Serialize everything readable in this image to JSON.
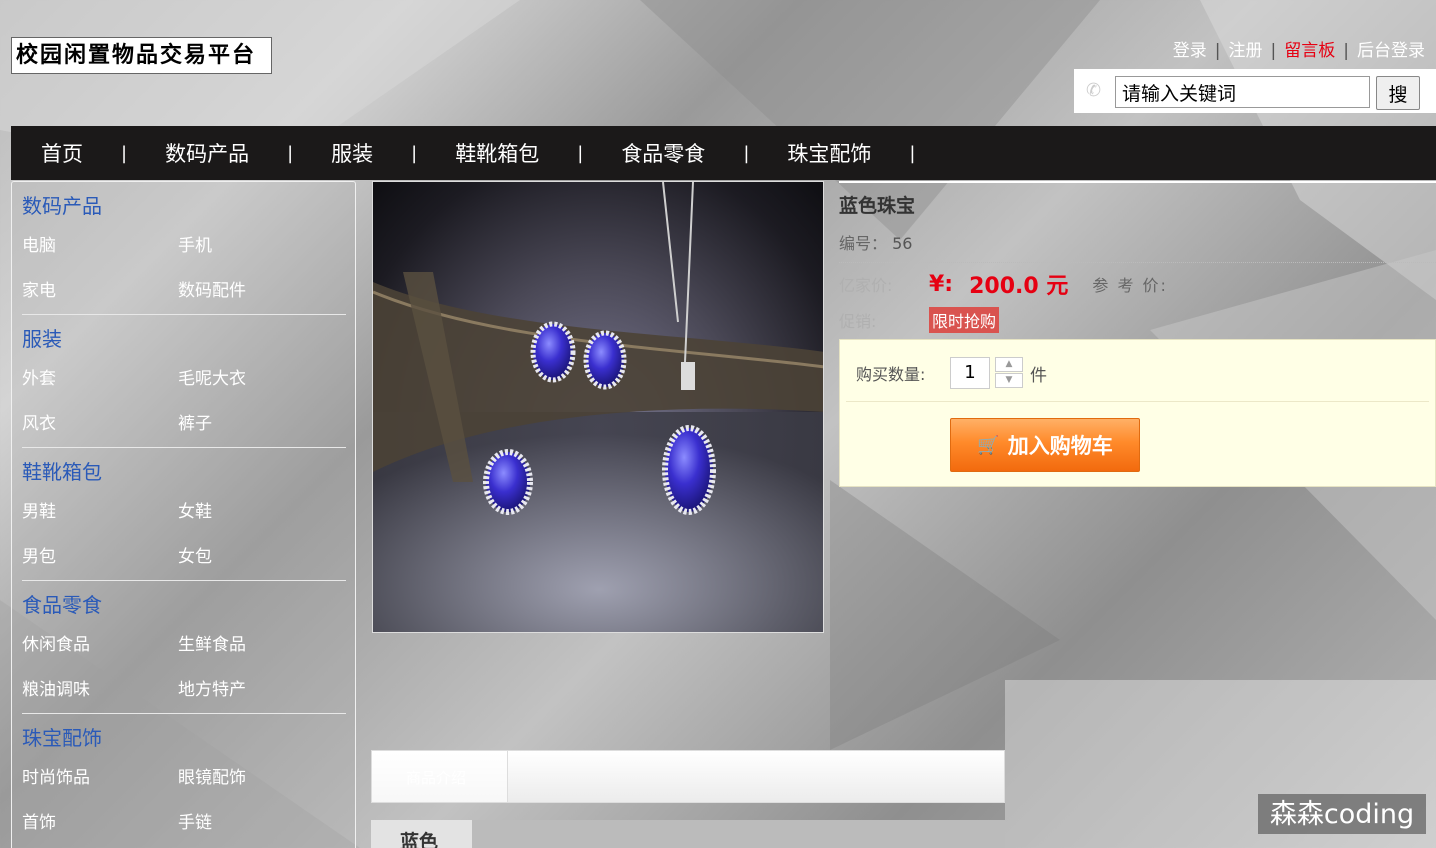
{
  "logo": {
    "text": "校园闲置物品交易平台"
  },
  "top_links": {
    "login": "登录",
    "register": "注册",
    "guestbook": "留言板",
    "admin": "后台登录",
    "sep": "|"
  },
  "search": {
    "value": "请输入关键词",
    "button": "搜"
  },
  "nav": {
    "items": [
      "首页",
      "数码产品",
      "服装",
      "鞋靴箱包",
      "食品零食",
      "珠宝配饰"
    ],
    "sep": "|"
  },
  "sidebar": [
    {
      "title": "数码产品",
      "items": [
        "电脑",
        "手机",
        "家电",
        "数码配件"
      ]
    },
    {
      "title": "服装",
      "items": [
        "外套",
        "毛呢大衣",
        "风衣",
        "裤子"
      ]
    },
    {
      "title": "鞋靴箱包",
      "items": [
        "男鞋",
        "女鞋",
        "男包",
        "女包"
      ]
    },
    {
      "title": "食品零食",
      "items": [
        "休闲食品",
        "生鲜食品",
        "粮油调味",
        "地方特产"
      ]
    },
    {
      "title": "珠宝配饰",
      "items": [
        "时尚饰品",
        "眼镜配饰",
        "首饰",
        "手链"
      ]
    }
  ],
  "product": {
    "name": "蓝色珠宝",
    "id_label": "编号：",
    "id": "56",
    "price_label": "亿家价:",
    "currency": "¥:",
    "price": "200.0 元",
    "ref_price_label": "参 考 价:",
    "promo_label": "促销:",
    "promo_badge": "限时抢购",
    "qty_label": "购买数量:",
    "qty": "1",
    "qty_unit": "件",
    "cart_button": "加入购物车"
  },
  "tabs": {
    "first_tab": "商品介绍",
    "detail_tab": "蓝色"
  },
  "watermark": "森森coding",
  "colors": {
    "nav_bg": "#1b1919",
    "accent_red": "#e60012",
    "category_blue": "#2a5ab8",
    "cart_orange": "#ff8a2a"
  }
}
